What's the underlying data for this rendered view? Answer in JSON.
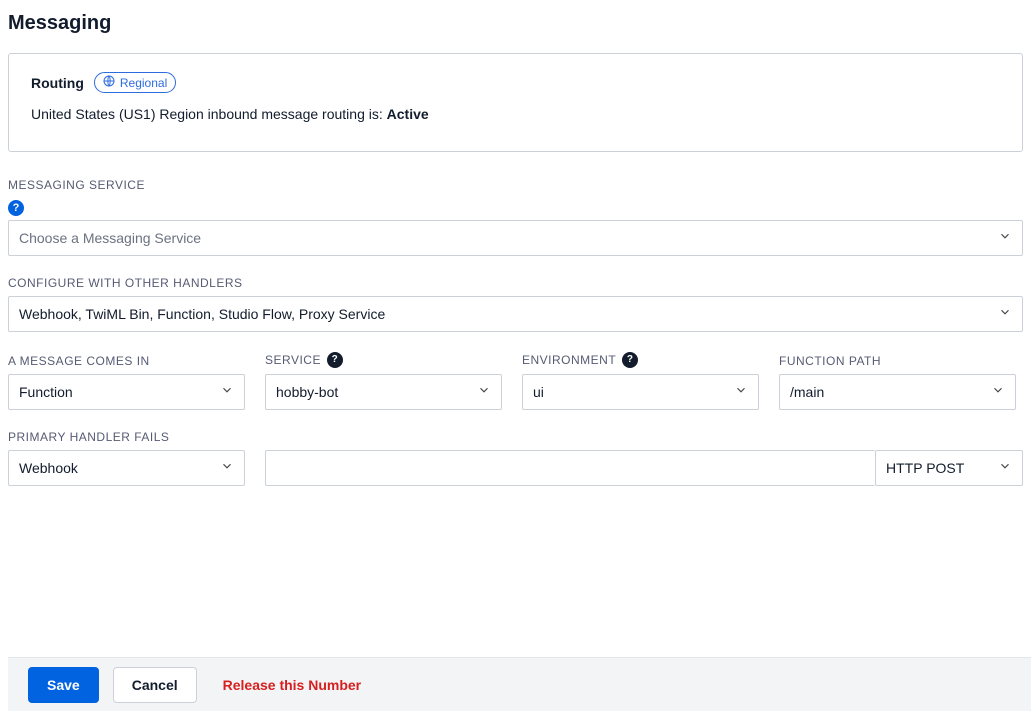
{
  "page": {
    "title": "Messaging"
  },
  "routing": {
    "label": "Routing",
    "badge": "Regional",
    "status_prefix": "United States (US1) Region inbound message routing is: ",
    "status_value": "Active"
  },
  "messaging_service": {
    "label": "MESSAGING SERVICE",
    "placeholder": "Choose a Messaging Service"
  },
  "configure_handlers": {
    "label": "CONFIGURE WITH OTHER HANDLERS",
    "value": "Webhook, TwiML Bin, Function, Studio Flow, Proxy Service"
  },
  "incoming": {
    "label": "A MESSAGE COMES IN",
    "value": "Function"
  },
  "service": {
    "label": "SERVICE",
    "value": "hobby-bot"
  },
  "environment": {
    "label": "ENVIRONMENT",
    "value": "ui"
  },
  "function_path": {
    "label": "FUNCTION PATH",
    "value": "/main"
  },
  "primary_fails": {
    "label": "PRIMARY HANDLER FAILS",
    "value": "Webhook",
    "url": "",
    "http_method": "HTTP POST"
  },
  "footer": {
    "save": "Save",
    "cancel": "Cancel",
    "release": "Release this Number"
  },
  "help_tooltip": "?"
}
